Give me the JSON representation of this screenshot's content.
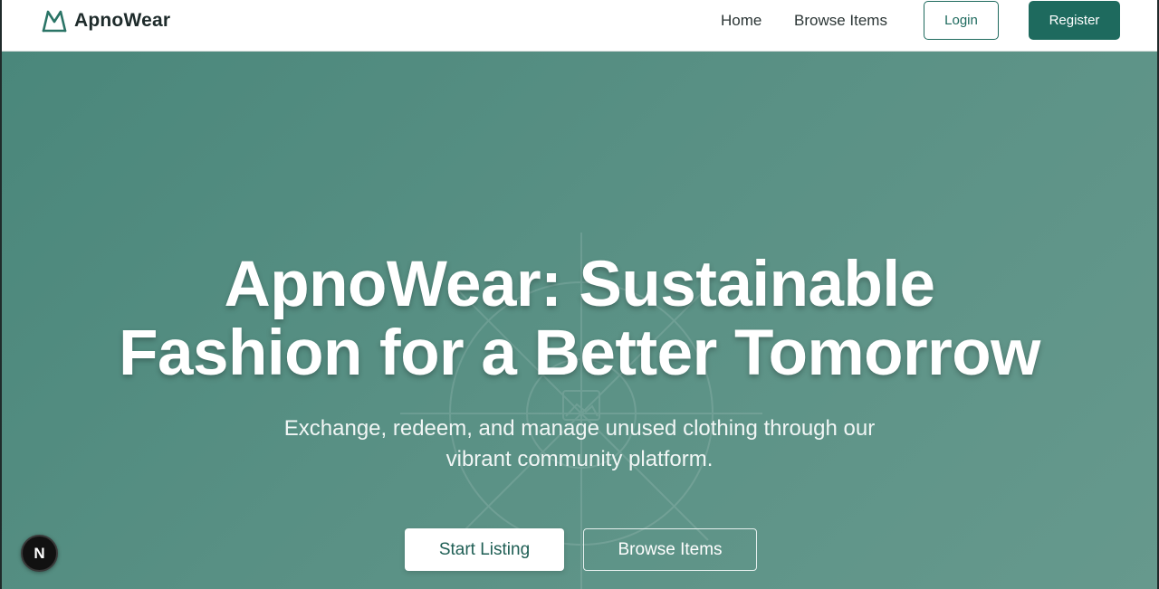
{
  "header": {
    "brand_name": "ApnoWear",
    "logo_icon": "mountain-logo-icon",
    "nav": {
      "home": "Home",
      "browse": "Browse Items"
    },
    "login_label": "Login",
    "register_label": "Register"
  },
  "hero": {
    "title_line1": "ApnoWear: Sustainable",
    "title_line2": "Fashion for a Better Tomorrow",
    "subtitle_line1": "Exchange, redeem, and manage unused clothing through our",
    "subtitle_line2": "vibrant community platform.",
    "start_label": "Start Listing",
    "browse_label": "Browse Items",
    "background_icon": "image-placeholder-icon"
  },
  "dev_badge": {
    "letter": "N",
    "icon": "nextjs-icon"
  },
  "colors": {
    "brand_primary": "#1e6a5e",
    "hero_gradient_start": "#4a877b",
    "hero_gradient_end": "#66998d",
    "text_dark": "#1e2b2b"
  }
}
